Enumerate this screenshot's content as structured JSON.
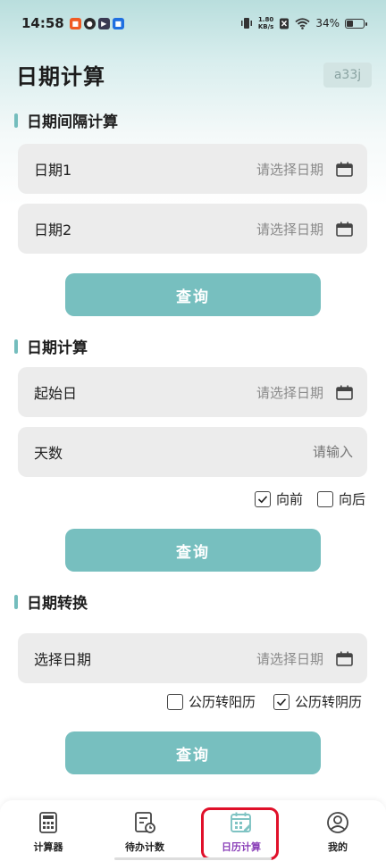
{
  "status_bar": {
    "time": "14:58",
    "net_speed_value": "1.80",
    "net_speed_unit": "KB/s",
    "battery": "34%"
  },
  "header": {
    "title": "日期计算",
    "badge": "a33j"
  },
  "interval_section": {
    "title": "日期间隔计算",
    "date1_label": "日期1",
    "date1_placeholder": "请选择日期",
    "date2_label": "日期2",
    "date2_placeholder": "请选择日期",
    "query_label": "查询"
  },
  "date_calc_section": {
    "title": "日期计算",
    "start_label": "起始日",
    "start_placeholder": "请选择日期",
    "days_label": "天数",
    "days_placeholder": "请输入",
    "forward_label": "向前",
    "forward_checked": true,
    "backward_label": "向后",
    "backward_checked": false,
    "query_label": "查询"
  },
  "convert_section": {
    "title": "日期转换",
    "select_label": "选择日期",
    "select_placeholder": "请选择日期",
    "solar_label": "公历转阳历",
    "solar_checked": false,
    "lunar_label": "公历转阴历",
    "lunar_checked": true,
    "query_label": "查询"
  },
  "bottom_nav": {
    "items": [
      {
        "label": "计算器",
        "icon": "calculator-icon"
      },
      {
        "label": "待办计数",
        "icon": "todo-icon"
      },
      {
        "label": "日历计算",
        "icon": "calendar-edit-icon",
        "active": true
      },
      {
        "label": "我的",
        "icon": "user-icon"
      }
    ]
  },
  "colors": {
    "accent": "#77bfbf",
    "active_nav": "#8a3fb8",
    "highlight": "#e0102a"
  }
}
